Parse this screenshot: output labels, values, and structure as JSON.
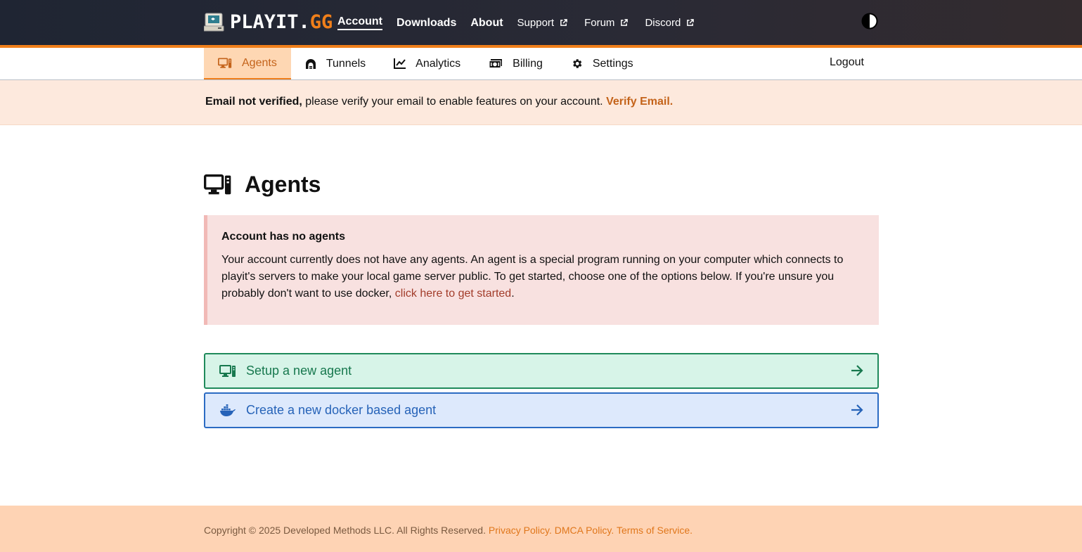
{
  "brand": {
    "logo_main": "PLAYIT.",
    "logo_accent": "GG",
    "accent_color": "#f07f1a"
  },
  "topnav": {
    "items": [
      {
        "label": "Account",
        "active": true
      },
      {
        "label": "Downloads"
      },
      {
        "label": "About"
      }
    ],
    "external": [
      {
        "label": "Support"
      },
      {
        "label": "Forum"
      },
      {
        "label": "Discord"
      }
    ],
    "theme_icon": "contrast-icon"
  },
  "subnav": {
    "items": [
      {
        "label": "Agents",
        "icon": "computer-icon",
        "active": true
      },
      {
        "label": "Tunnels",
        "icon": "tunnel-icon"
      },
      {
        "label": "Analytics",
        "icon": "chart-line-icon"
      },
      {
        "label": "Billing",
        "icon": "money-icon"
      },
      {
        "label": "Settings",
        "icon": "gear-icon"
      }
    ],
    "logout": "Logout"
  },
  "banner": {
    "strong": "Email not verified,",
    "text": " please verify your email to enable features on your account. ",
    "link": "Verify Email."
  },
  "page": {
    "title": "Agents",
    "title_icon": "computer-icon"
  },
  "notice": {
    "title": "Account has no agents",
    "body": "Your account currently does not have any agents. An agent is a special program running on your computer which connects to playit's servers to make your local game server public. To get started, choose one of the options below. If you're unsure you probably don't want to use docker, ",
    "link": "click here to get started",
    "end": "."
  },
  "actions": [
    {
      "label": "Setup a new agent",
      "icon": "computer-icon",
      "color": "#17784e"
    },
    {
      "label": "Create a new docker based agent",
      "icon": "docker-icon",
      "color": "#2663b8"
    }
  ],
  "footer": {
    "copyright": "Copyright © 2025 Developed Methods LLC. All Rights Reserved. ",
    "links": [
      "Privacy Policy.",
      "DMCA Policy.",
      "Terms of Service."
    ]
  }
}
